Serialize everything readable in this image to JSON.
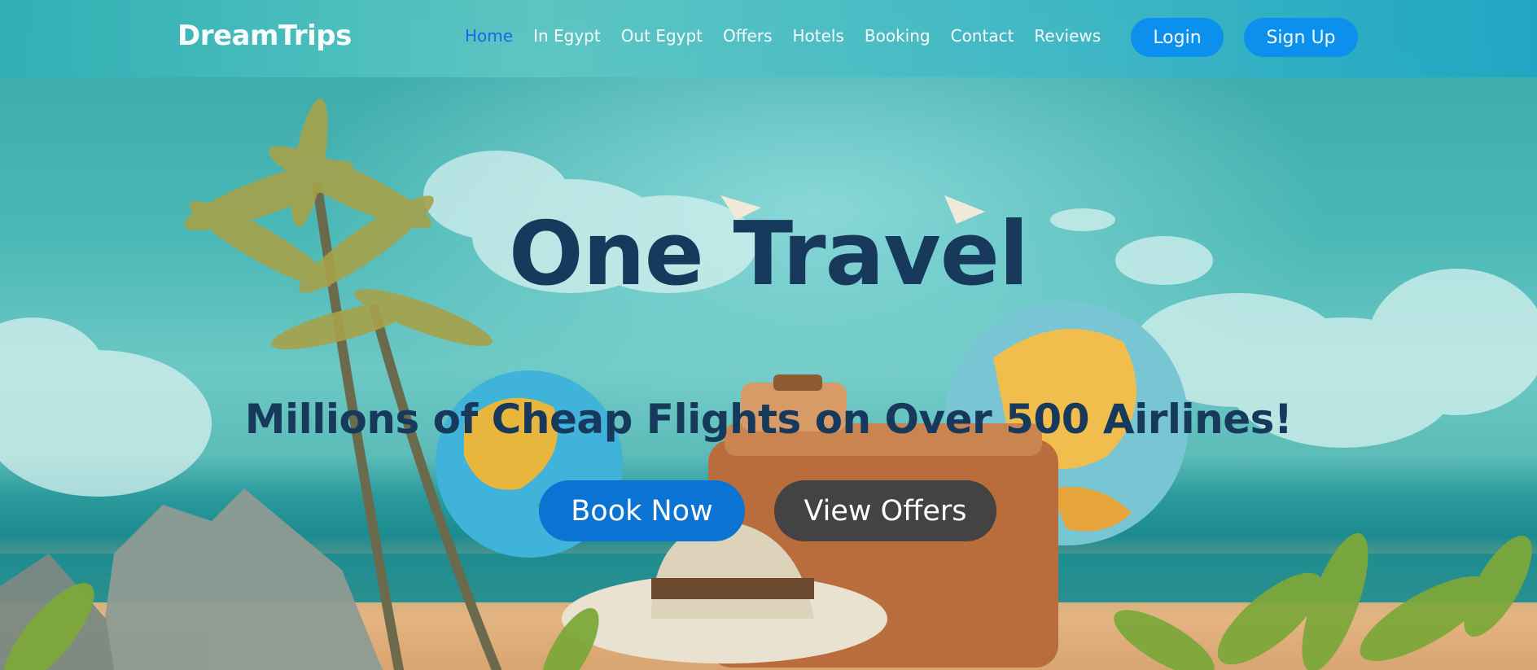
{
  "brand": "DreamTrips",
  "nav": {
    "links": [
      {
        "label": "Home",
        "active": true
      },
      {
        "label": "In Egypt",
        "active": false
      },
      {
        "label": "Out Egypt",
        "active": false
      },
      {
        "label": "Offers",
        "active": false
      },
      {
        "label": "Hotels",
        "active": false
      },
      {
        "label": "Booking",
        "active": false
      },
      {
        "label": "Contact",
        "active": false
      },
      {
        "label": "Reviews",
        "active": false
      }
    ],
    "login_label": "Login",
    "signup_label": "Sign Up"
  },
  "hero": {
    "title": "One Travel",
    "subtitle": "Millions of Cheap Flights on Over 500 Airlines!",
    "book_label": "Book Now",
    "offers_label": "View Offers",
    "background_icon": "travel-beach-illustration"
  },
  "colors": {
    "accent_blue": "#0a8ff0",
    "active_link": "#1667e6",
    "hero_text": "#173a5c",
    "book_button": "#0b73d4",
    "offers_button": "#434343"
  }
}
